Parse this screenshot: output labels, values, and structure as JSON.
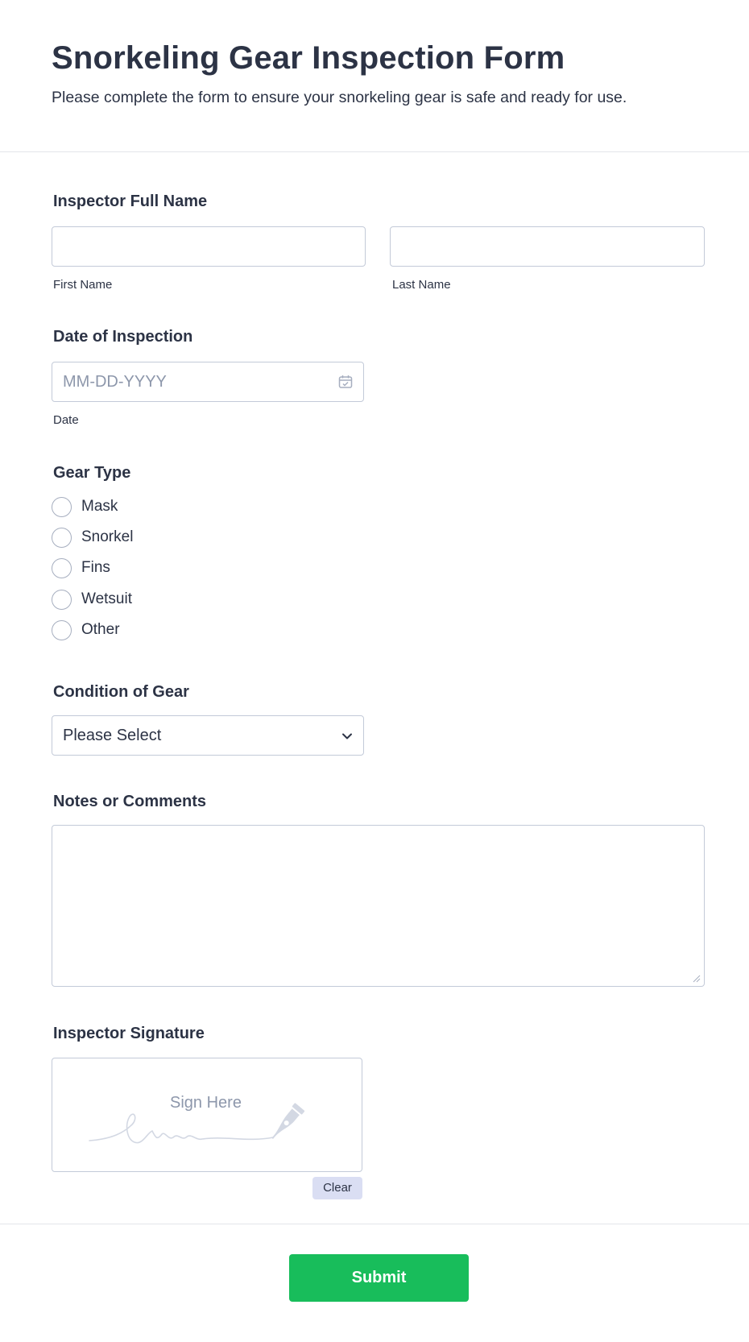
{
  "form": {
    "title": "Snorkeling Gear Inspection Form",
    "subtitle": "Please complete the form to ensure your snorkeling gear is safe and ready for use."
  },
  "inspector_name": {
    "label": "Inspector Full Name",
    "first_sublabel": "First Name",
    "last_sublabel": "Last Name",
    "first_value": "",
    "last_value": ""
  },
  "inspection_date": {
    "label": "Date of Inspection",
    "placeholder": "MM-DD-YYYY",
    "sublabel": "Date",
    "icon": "calendar-icon"
  },
  "gear_type": {
    "label": "Gear Type",
    "options": [
      "Mask",
      "Snorkel",
      "Fins",
      "Wetsuit",
      "Other"
    ],
    "selected": null
  },
  "condition": {
    "label": "Condition of Gear",
    "selected": "Please Select",
    "icon": "chevron-down-icon"
  },
  "notes": {
    "label": "Notes or Comments",
    "value": ""
  },
  "signature": {
    "label": "Inspector Signature",
    "placeholder": "Sign Here",
    "clear_label": "Clear",
    "icon": "pen-nib-icon"
  },
  "actions": {
    "submit_label": "Submit"
  },
  "colors": {
    "text": "#2c3345",
    "placeholder": "#8d97ab",
    "border": "#c3cad8",
    "submit_bg": "#18bd5b",
    "clear_bg": "#dadef3"
  }
}
